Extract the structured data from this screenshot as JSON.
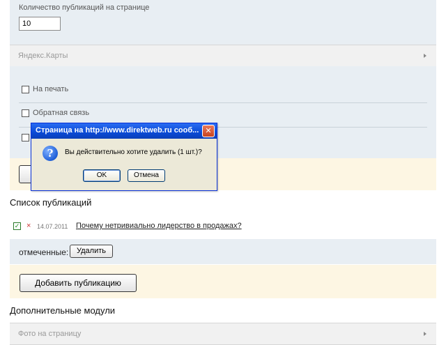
{
  "settings": {
    "per_page_label": "Количество публикаций на странице",
    "per_page_value": "10",
    "yandex_maps": "Яндекс.Карты",
    "options": [
      {
        "label": "На печать",
        "checked": false
      },
      {
        "label": "Обратная связь",
        "checked": false
      }
    ]
  },
  "dialog": {
    "title": "Страница на http://www.direktweb.ru сооб...",
    "close_glyph": "✕",
    "icon_glyph": "?",
    "message": "Вы действительно хотите удалить (1 шт.)?",
    "ok": "OK",
    "cancel": "Отмена"
  },
  "publications": {
    "title": "Список публикаций",
    "items": [
      {
        "checked": true,
        "delete_glyph": "×",
        "date": "14.07.2011",
        "title": "Почему нетривиально лидерство в продажах?"
      }
    ],
    "marked_label": "отмеченные:",
    "delete_button": "Удалить",
    "add_button": "Добавить публикацию"
  },
  "modules": {
    "title": "Дополнительные модули",
    "first": "Фото на страницу"
  },
  "colors": {
    "panel_blue": "#e8eef3",
    "panel_cream": "#fdf6e3",
    "dialog_title": "#0a4ad6"
  }
}
